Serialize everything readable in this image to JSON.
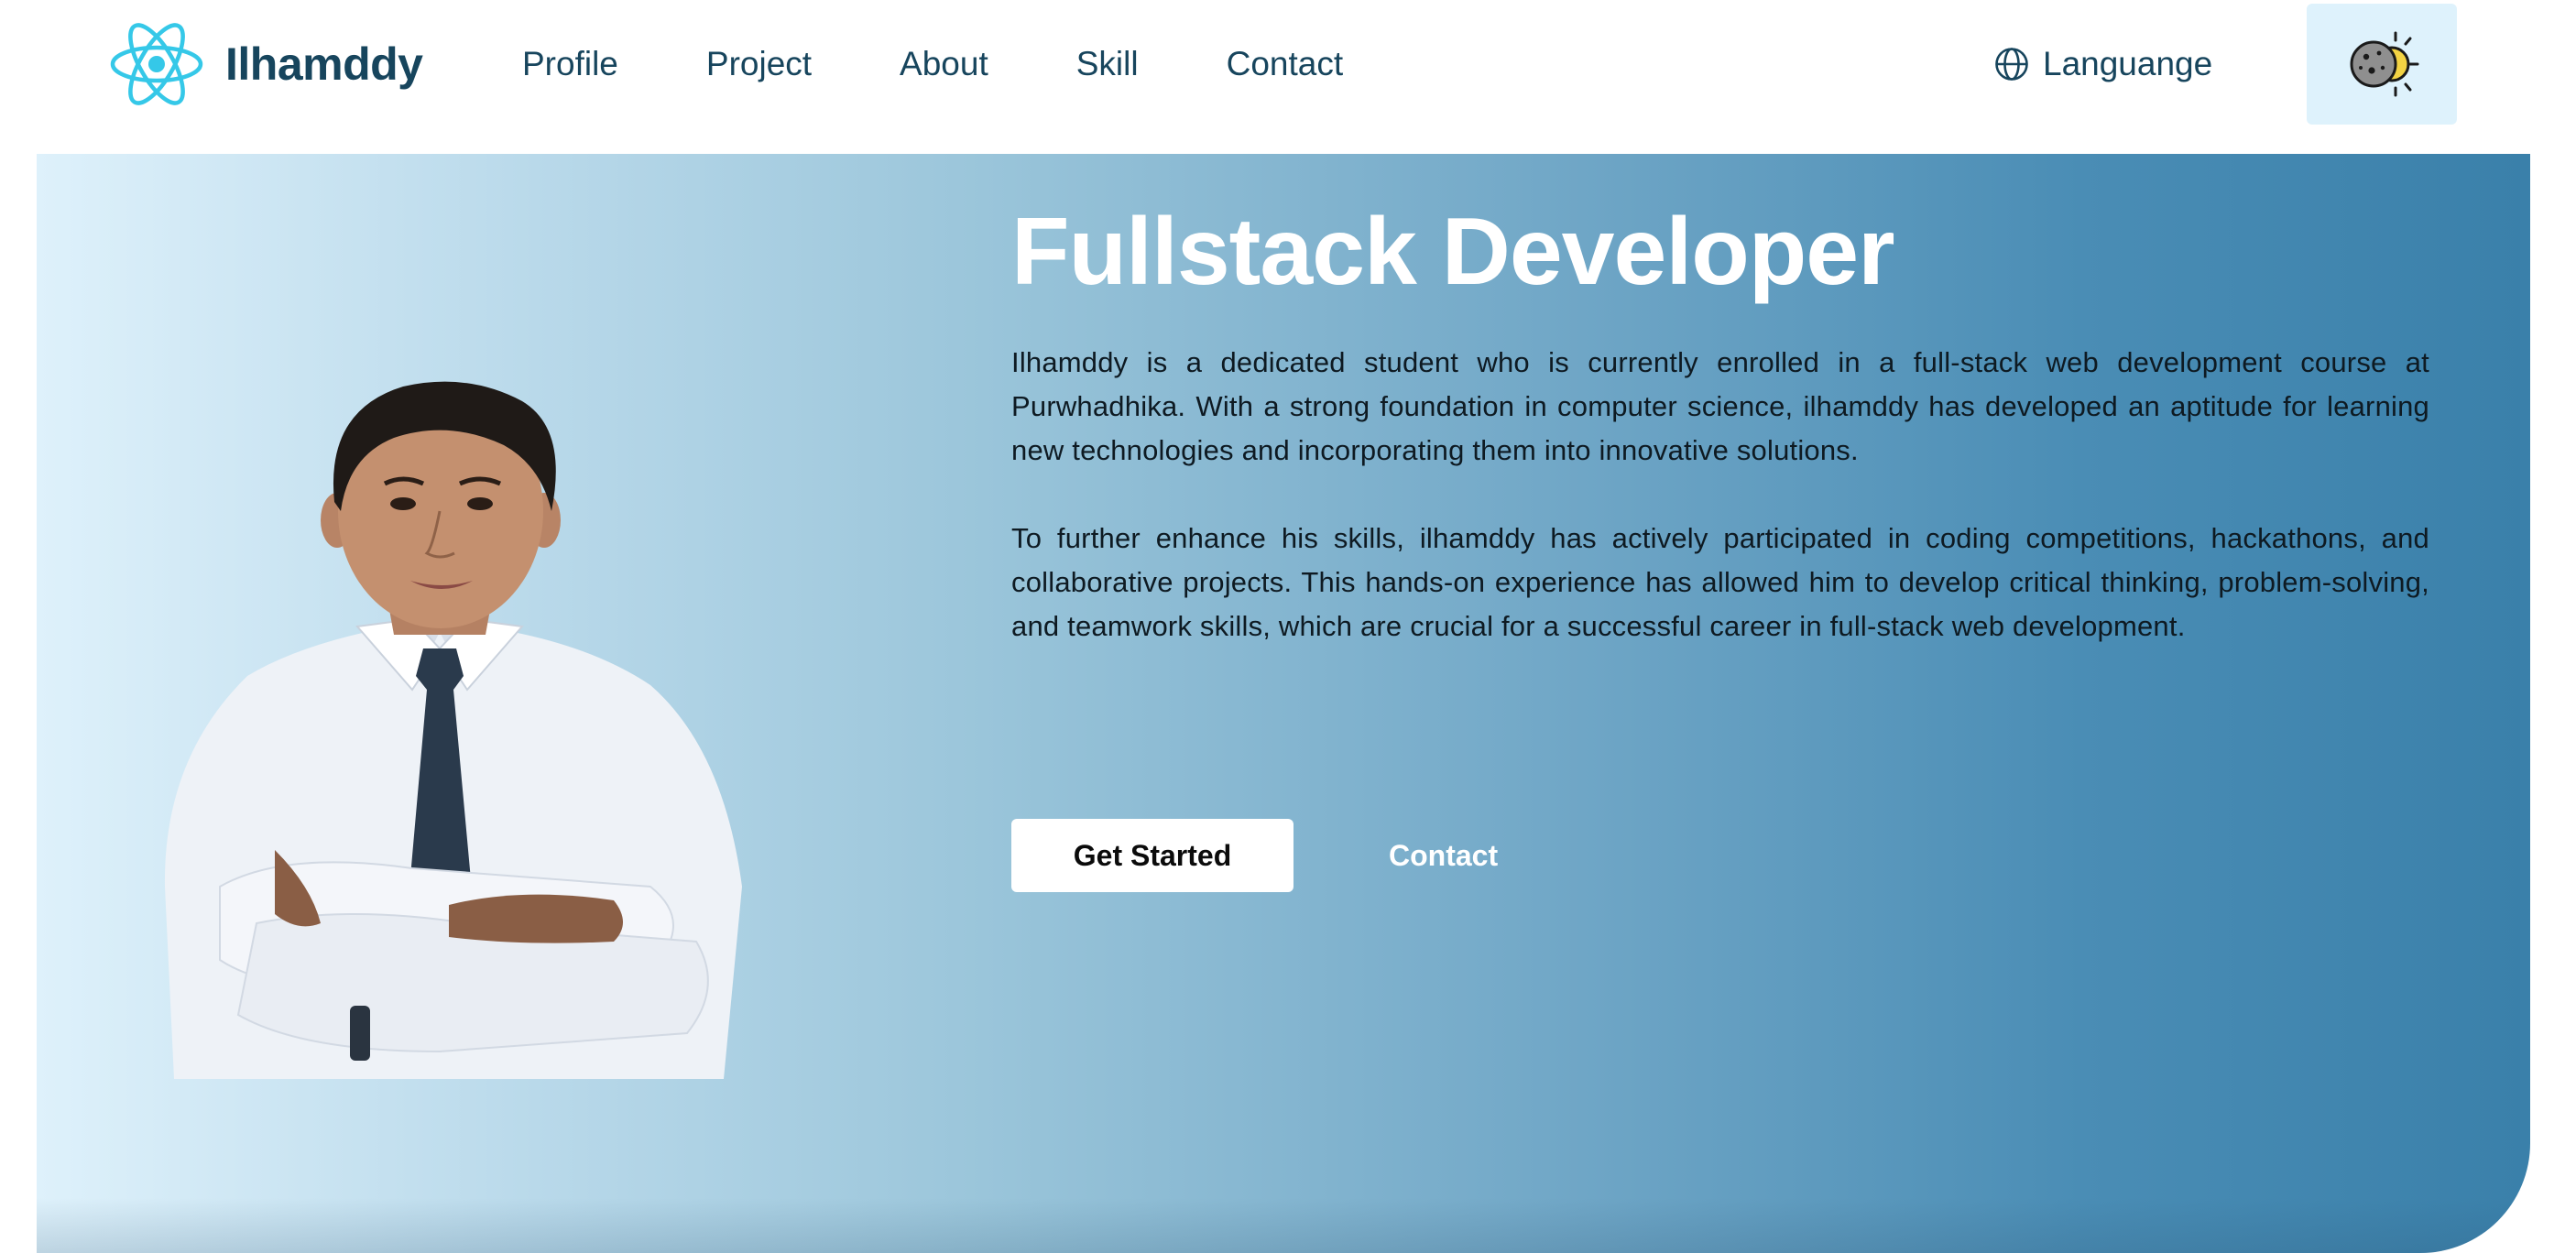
{
  "brand": {
    "name": "Ilhamddy",
    "logo_icon": "react-atom-icon",
    "logo_color": "#35c8e8"
  },
  "nav": {
    "links": [
      {
        "label": "Profile"
      },
      {
        "label": "Project"
      },
      {
        "label": "About"
      },
      {
        "label": "Skill"
      },
      {
        "label": "Contact"
      }
    ],
    "language": {
      "label": "Languange",
      "icon": "globe-icon"
    },
    "theme_toggle": {
      "icon": "moon-sun-icon",
      "background": "#def2fc"
    }
  },
  "hero": {
    "title": "Fullstack Developer",
    "paragraphs": [
      "Ilhamddy is a dedicated student who is currently enrolled in a full-stack web development course at Purwhadhika. With a strong foundation in computer science, ilhamddy has developed an aptitude for learning new technologies and incorporating them into innovative solutions.",
      "To further enhance his skills, ilhamddy has actively participated in coding competitions, hackathons, and collaborative projects. This hands-on experience has allowed him to develop critical thinking, problem-solving, and teamwork skills, which are crucial for a successful career in full-stack web development."
    ],
    "primary_button": "Get Started",
    "secondary_button": "Contact"
  },
  "colors": {
    "text_dark": "#17455d",
    "gradient_start": "#def1fb",
    "gradient_end": "#3a80aa",
    "title": "#ffffff"
  }
}
